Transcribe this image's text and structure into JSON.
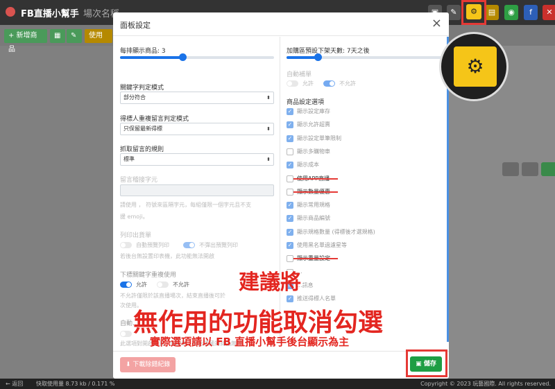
{
  "app": {
    "title": "FB直播小幫手",
    "page_name": "場次名稱"
  },
  "toolbar": {
    "buttons": [
      {
        "icon": "print-icon",
        "color": "#555555",
        "glyph": "▣"
      },
      {
        "icon": "wrench-icon",
        "color": "#555555",
        "glyph": "✎"
      },
      {
        "icon": "gear-icon",
        "color": "#f5c518",
        "glyph": "⚙"
      },
      {
        "icon": "archive-icon",
        "color": "#b58900",
        "glyph": "▤"
      },
      {
        "icon": "line-icon",
        "color": "#2e9e44",
        "glyph": "◉"
      },
      {
        "icon": "facebook-icon",
        "color": "#2d5fb7",
        "glyph": "f"
      },
      {
        "icon": "trash-icon",
        "color": "#c9302c",
        "glyph": "✕"
      }
    ]
  },
  "actions": {
    "add_product": "+ 新增商品",
    "use_tag": "使用"
  },
  "modal": {
    "title": "面板設定",
    "close": "×",
    "left": {
      "per_row_label": "每排顯示商品: 3",
      "per_row_value": 3,
      "keyword_mode_label": "關鍵字判定模式",
      "keyword_mode_value": "部分符合",
      "dup_mode_label": "得標人重複留言判定模式",
      "dup_mode_value": "只保留最新得標",
      "grab_rule_label": "抓取留言的規則",
      "grab_rule_value": "標準",
      "connector_label": "留言稽接字元",
      "connector_help_1": "請使用  ，  符號來區隔字元，每組僅限一個字元且不支",
      "connector_help_2": "援 emoji。",
      "print_label": "列印出貨單",
      "print_opt1": "自動預覽列印",
      "print_opt2": "不彈出預覽列印",
      "print_help": "若後台無設置印表機，此功能無法開啟",
      "reuse_label": "下標關鍵字重複使用",
      "reuse_allow": "允許",
      "reuse_deny": "不允許",
      "reuse_help_1": "不允許僅限於該直播場次，結束直播後可於",
      "reuse_help_2": "次使用。",
      "auto_label": "自動...",
      "auto_help": "此選項對開啟超賣、無規格、後台隱藏的商品無效"
    },
    "right": {
      "days_label": "加購區預設下架天數: 7天之後",
      "days_value": 7,
      "auto_fill_label": "自動補單",
      "auto_fill_allow": "允許",
      "auto_fill_deny": "不允許",
      "product_options_label": "商品設定選項",
      "options": [
        {
          "label": "顯示設定庫存",
          "checked": true,
          "struck": false
        },
        {
          "label": "顯示允許超賣",
          "checked": true,
          "struck": false
        },
        {
          "label": "顯示設定單筆限制",
          "checked": true,
          "struck": false
        },
        {
          "label": "顯示多購物車",
          "checked": false,
          "struck": false
        },
        {
          "label": "顯示成本",
          "checked": true,
          "struck": false
        },
        {
          "label": "使用APP直播",
          "checked": false,
          "struck": true
        },
        {
          "label": "顯示數量優惠",
          "checked": false,
          "struck": true
        },
        {
          "label": "顯示常用規格",
          "checked": true,
          "struck": false
        },
        {
          "label": "顯示商品編號",
          "checked": true,
          "struck": false
        },
        {
          "label": "顯示規格數量 (得標後才選規格)",
          "checked": true,
          "struck": false
        },
        {
          "label": "使用黑名單過濾星等",
          "checked": true,
          "struck": false
        },
        {
          "label": "顯示重量設定",
          "checked": false,
          "struck": true
        },
        {
          "label": "...",
          "checked": false,
          "struck": false
        },
        {
          "label": "...訊息",
          "checked": true,
          "struck": false
        },
        {
          "label": "推送得標人名單",
          "checked": true,
          "struck": false
        }
      ]
    },
    "download_label": "下載除錯紀錄",
    "save_label": "儲存"
  },
  "annotations": {
    "line1": "建議將",
    "line2": "無作用的功能取消勾選",
    "line3": "實際選項請以 FB 直播小幫手後台顯示為主"
  },
  "footer": {
    "back": "← 返回",
    "usage": "快取使用量 8.73 kb / 0.171 %",
    "copyright": "Copyright © 2023 玩藝國際. All rights reserved."
  }
}
